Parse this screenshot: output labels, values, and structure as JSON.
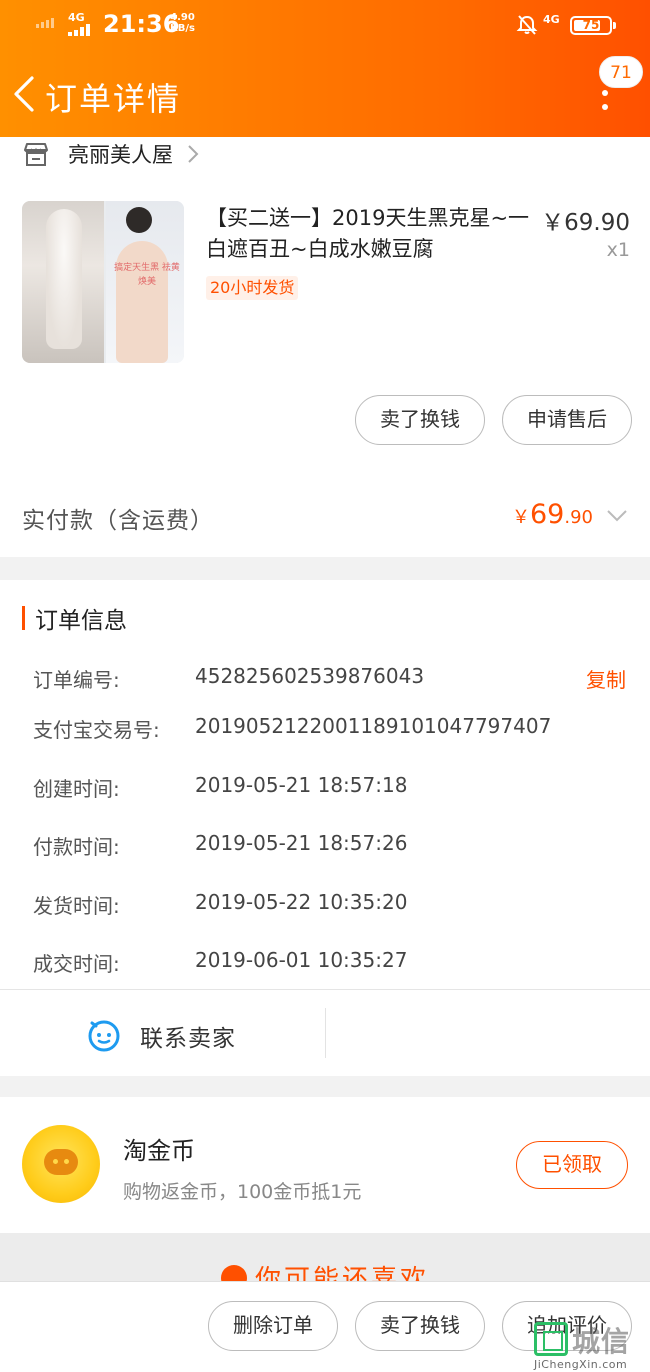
{
  "status_bar": {
    "network": "4G",
    "time": "21:36",
    "speed_value": "4.90",
    "speed_unit": "KB/s",
    "network_right": "4G",
    "battery": "75",
    "battery_level_percent": 75
  },
  "header": {
    "title": "订单详情",
    "message_count": "71",
    "back_icon": "back-arrow-icon",
    "more_icon": "more-vertical-icon"
  },
  "shop": {
    "name": "亮丽美人屋",
    "icon": "shop-icon"
  },
  "product": {
    "title": "【买二送一】2019天生黑克星~一白遮百丑~白成水嫩豆腐",
    "price": "￥69.90",
    "quantity": "x1",
    "shipping_tag": "20小时发货",
    "image_promo_text": "搞定天生黑 祛黄 焕美"
  },
  "product_actions": {
    "sell_label": "卖了换钱",
    "aftersale_label": "申请售后"
  },
  "payment": {
    "label": "实付款（含运费）",
    "currency": "￥",
    "amount_main": "69",
    "amount_decimal": ".90"
  },
  "order_info": {
    "title": "订单信息",
    "copy_label": "复制",
    "rows": [
      {
        "label": "订单编号:",
        "value": "452825602539876043"
      },
      {
        "label": "支付宝交易号:",
        "value": "2019052122001189101047797407"
      },
      {
        "label": "创建时间:",
        "value": "2019-05-21 18:57:18"
      },
      {
        "label": "付款时间:",
        "value": "2019-05-21 18:57:26"
      },
      {
        "label": "发货时间:",
        "value": "2019-05-22 10:35:20"
      },
      {
        "label": "成交时间:",
        "value": "2019-06-01 10:35:27"
      }
    ]
  },
  "contact": {
    "label": "联系卖家",
    "icon": "chat-bubble-icon"
  },
  "coins": {
    "title": "淘金币",
    "description": "购物返金币，100金币抵1元",
    "button_label": "已领取"
  },
  "recommend": {
    "title": "你可能还喜欢"
  },
  "bottom_actions": {
    "delete_label": "删除订单",
    "sell_label": "卖了换钱",
    "review_label": "追加评价"
  },
  "watermark": {
    "text": "城信",
    "sub": "JiChengXin.com"
  },
  "colors": {
    "brand_orange": "#ff5000",
    "header_gradient_start": "#ff9000",
    "header_gradient_end": "#ff5000"
  }
}
